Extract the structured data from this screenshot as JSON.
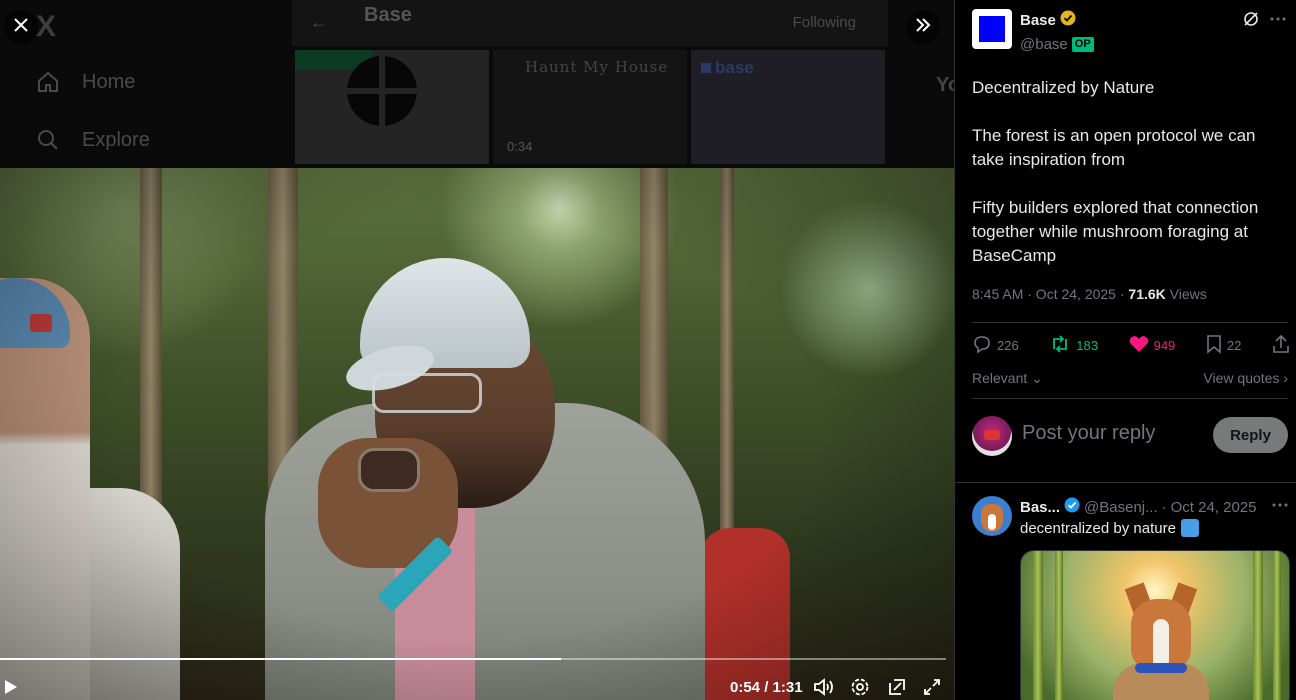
{
  "background_ui": {
    "logo": "X",
    "nav": [
      {
        "label": "Home",
        "icon": "home-icon"
      },
      {
        "label": "Explore",
        "icon": "search-icon"
      }
    ],
    "profile_header": {
      "name": "Base",
      "tab": "Following"
    },
    "tiles": [
      {
        "label": ""
      },
      {
        "label": "Haunt My House",
        "duration": "0:34"
      },
      {
        "label": "base"
      }
    ],
    "right_cut_text": "Yo"
  },
  "video": {
    "current_time": "0:54",
    "total_time": "1:31",
    "time_display": "0:54 / 1:31",
    "progress_fraction": 0.593,
    "controls": [
      "play-icon",
      "volume-icon",
      "settings-icon",
      "pip-icon",
      "fullscreen-icon"
    ]
  },
  "tweet": {
    "author_name": "Base",
    "author_handle": "@base",
    "badge": "OP",
    "paragraphs": [
      "Decentralized by Nature",
      "The forest is an open protocol we can take inspiration from",
      "Fifty builders explored that connection together while mushroom foraging at BaseCamp"
    ],
    "time": "8:45 AM · Oct 24, 2025 · ",
    "views_count": "71.6K",
    "views_label": " Views",
    "stats": {
      "replies": "226",
      "reposts": "183",
      "likes": "949",
      "bookmarks": "22"
    },
    "sort_label": "Relevant",
    "view_quotes": "View quotes"
  },
  "reply_box": {
    "placeholder": "Post your reply",
    "button": "Reply"
  },
  "reply": {
    "name": "Bas...",
    "handle": "@Basenj...",
    "sep": "·",
    "date": "Oct 24, 2025",
    "text": "decentralized by nature"
  },
  "colors": {
    "accent_green": "#00ba7c",
    "like_pink": "#f91880",
    "verified_blue": "#1d9bf0",
    "gold": "#e2b719",
    "muted": "#71767b"
  }
}
